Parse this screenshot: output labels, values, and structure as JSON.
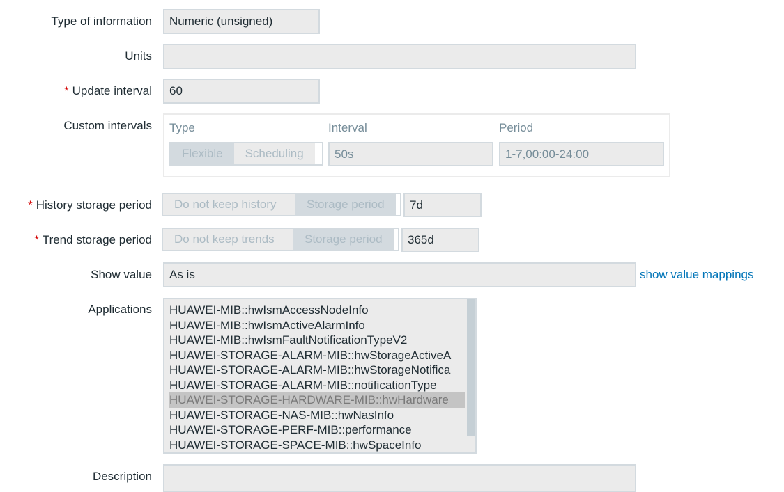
{
  "labels": {
    "type": "Type of information",
    "units": "Units",
    "update": "Update interval",
    "custom": "Custom intervals",
    "history": "History storage period",
    "trend": "Trend storage period",
    "show": "Show value",
    "apps": "Applications",
    "desc": "Description"
  },
  "required_mark": "*",
  "type_value": "Numeric (unsigned)",
  "units_value": "",
  "update_value": "60",
  "custom": {
    "col_type": "Type",
    "col_interval": "Interval",
    "col_period": "Period",
    "flexible": "Flexible",
    "scheduling": "Scheduling",
    "interval": "50s",
    "period": "1-7,00:00-24:00"
  },
  "history": {
    "off": "Do not keep history",
    "on": "Storage period",
    "value": "7d"
  },
  "trend": {
    "off": "Do not keep trends",
    "on": "Storage period",
    "value": "365d"
  },
  "show_value": "As is",
  "show_value_link": "show value mappings",
  "applications": [
    "HUAWEI-MIB::hwIsmAccessNodeInfo",
    "HUAWEI-MIB::hwIsmActiveAlarmInfo",
    "HUAWEI-MIB::hwIsmFaultNotificationTypeV2",
    "HUAWEI-STORAGE-ALARM-MIB::hwStorageActiveA",
    "HUAWEI-STORAGE-ALARM-MIB::hwStorageNotifica",
    "HUAWEI-STORAGE-ALARM-MIB::notificationType",
    "HUAWEI-STORAGE-HARDWARE-MIB::hwHardware",
    "HUAWEI-STORAGE-NAS-MIB::hwNasInfo",
    "HUAWEI-STORAGE-PERF-MIB::performance",
    "HUAWEI-STORAGE-SPACE-MIB::hwSpaceInfo"
  ]
}
